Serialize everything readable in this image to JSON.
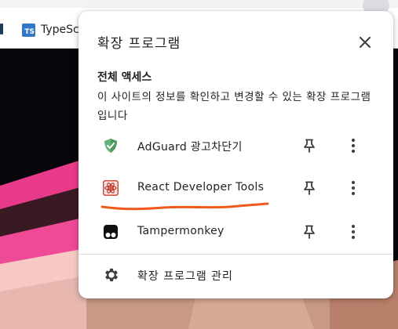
{
  "browser": {
    "bookmarks": [
      {
        "badge": "TS",
        "label": "TypeSc"
      }
    ]
  },
  "popup": {
    "title": "확장 프로그램",
    "section_title": "전체 액세스",
    "section_desc": "이 사이트의 정보를 확인하고 변경할 수 있는 확장 프로그램입니다",
    "extensions": [
      {
        "name": "AdGuard 광고차단기",
        "icon": "adguard-shield-icon"
      },
      {
        "name": "React Developer Tools",
        "icon": "react-atom-icon"
      },
      {
        "name": "Tampermonkey",
        "icon": "tampermonkey-icon"
      }
    ],
    "manage_label": "확장 프로그램 관리"
  },
  "colors": {
    "annotation": "#f05a1a",
    "adguard": "#67b279",
    "react_icon_bg": "#d94a3b",
    "ts_badge": "#3178c6"
  }
}
